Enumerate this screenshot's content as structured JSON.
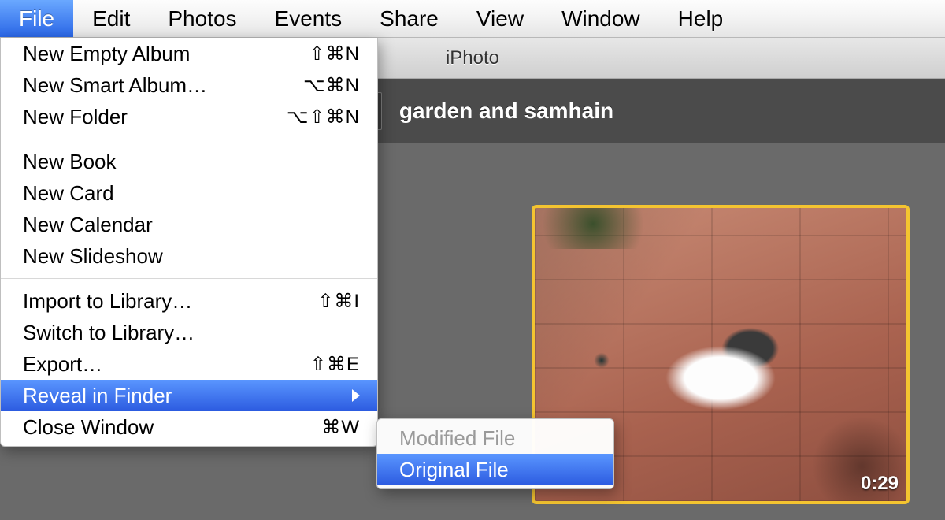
{
  "menubar": {
    "items": [
      {
        "label": "File",
        "active": true
      },
      {
        "label": "Edit"
      },
      {
        "label": "Photos"
      },
      {
        "label": "Events"
      },
      {
        "label": "Share"
      },
      {
        "label": "View"
      },
      {
        "label": "Window"
      },
      {
        "label": "Help"
      }
    ]
  },
  "dropdown": {
    "groups": [
      [
        {
          "label": "New Empty Album",
          "shortcut": "⇧⌘N"
        },
        {
          "label": "New Smart Album…",
          "shortcut": "⌥⌘N"
        },
        {
          "label": "New Folder",
          "shortcut": "⌥⇧⌘N"
        }
      ],
      [
        {
          "label": "New Book"
        },
        {
          "label": "New Card"
        },
        {
          "label": "New Calendar"
        },
        {
          "label": "New Slideshow"
        }
      ],
      [
        {
          "label": "Import to Library…",
          "shortcut": "⇧⌘I"
        },
        {
          "label": "Switch to Library…"
        },
        {
          "label": "Export…",
          "shortcut": "⇧⌘E"
        },
        {
          "label": "Reveal in Finder",
          "submenu": true,
          "highlight": true
        },
        {
          "label": "Close Window",
          "shortcut": "⌘W"
        }
      ]
    ]
  },
  "submenu": {
    "items": [
      {
        "label": "Modified File",
        "disabled": true
      },
      {
        "label": "Original File",
        "highlight": true
      }
    ]
  },
  "app": {
    "title": "iPhoto",
    "event_title": "garden and samhain",
    "thumb_duration": "0:29"
  }
}
